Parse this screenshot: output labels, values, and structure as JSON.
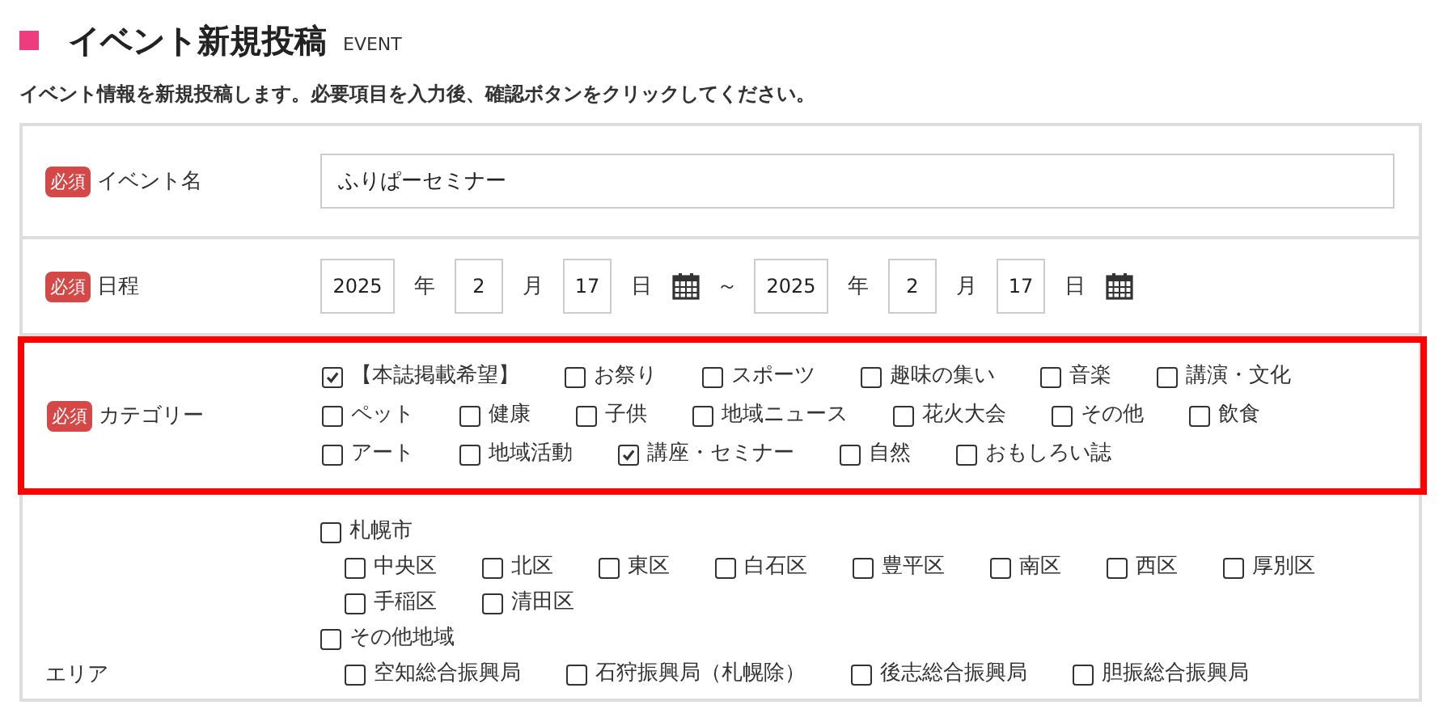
{
  "header": {
    "title": "イベント新規投稿",
    "subtitle": "EVENT"
  },
  "description": "イベント情報を新規投稿します。必要項目を入力後、確認ボタンをクリックしてください。",
  "form": {
    "rows": [
      {
        "kind": "text",
        "badge": "必須",
        "label": "イベント名",
        "highlighted": false,
        "value": "ふりぱーセミナー"
      },
      {
        "kind": "date",
        "badge": "必須",
        "label": "日程",
        "highlighted": false,
        "start": [
          {
            "value": "2025",
            "unit": "年"
          },
          {
            "value": "2",
            "unit": "月"
          },
          {
            "value": "17",
            "unit": "日"
          }
        ],
        "separator": "～",
        "end": [
          {
            "value": "2025",
            "unit": "年"
          },
          {
            "value": "2",
            "unit": "月"
          },
          {
            "value": "17",
            "unit": "日"
          }
        ]
      },
      {
        "kind": "checks",
        "badge": "必須",
        "label": "カテゴリー",
        "highlighted": true,
        "options": [
          {
            "label": "【本誌掲載希望】",
            "checked": true
          },
          {
            "label": "お祭り",
            "checked": false
          },
          {
            "label": "スポーツ",
            "checked": false
          },
          {
            "label": "趣味の集い",
            "checked": false
          },
          {
            "label": "音楽",
            "checked": false
          },
          {
            "label": "講演・文化",
            "checked": false
          },
          {
            "label": "ペット",
            "checked": false
          },
          {
            "label": "健康",
            "checked": false
          },
          {
            "label": "子供",
            "checked": false
          },
          {
            "label": "地域ニュース",
            "checked": false
          },
          {
            "label": "花火大会",
            "checked": false
          },
          {
            "label": "その他",
            "checked": false
          },
          {
            "label": "飲食",
            "checked": false
          },
          {
            "label": "アート",
            "checked": false
          },
          {
            "label": "地域活動",
            "checked": false
          },
          {
            "label": "講座・セミナー",
            "checked": true
          },
          {
            "label": "自然",
            "checked": false
          },
          {
            "label": "おもしろい誌",
            "checked": false
          }
        ]
      },
      {
        "kind": "tree",
        "label": "エリア",
        "highlighted": false,
        "options": [
          {
            "label": "札幌市",
            "checked": false,
            "children": [
              {
                "label": "中央区",
                "checked": false
              },
              {
                "label": "北区",
                "checked": false
              },
              {
                "label": "東区",
                "checked": false
              },
              {
                "label": "白石区",
                "checked": false
              },
              {
                "label": "豊平区",
                "checked": false
              },
              {
                "label": "南区",
                "checked": false
              },
              {
                "label": "西区",
                "checked": false
              },
              {
                "label": "厚別区",
                "checked": false
              },
              {
                "label": "手稲区",
                "checked": false
              },
              {
                "label": "清田区",
                "checked": false
              }
            ]
          },
          {
            "label": "その他地域",
            "checked": false,
            "children": [
              {
                "label": "空知総合振興局",
                "checked": false
              },
              {
                "label": "石狩振興局（札幌除）",
                "checked": false
              },
              {
                "label": "後志総合振興局",
                "checked": false
              },
              {
                "label": "胆振総合振興局",
                "checked": false
              }
            ]
          }
        ]
      }
    ]
  }
}
